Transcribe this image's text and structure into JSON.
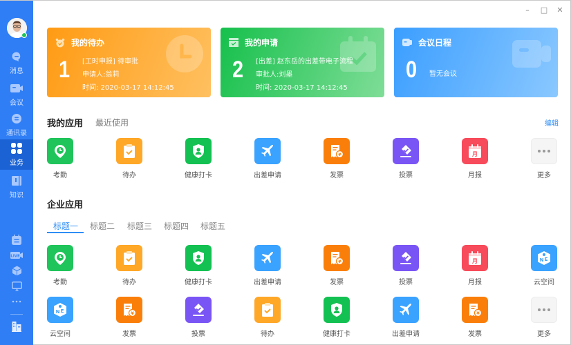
{
  "window": {
    "controls": {
      "minimize": "–",
      "maximize": "□",
      "close": "✕"
    }
  },
  "sidebar": {
    "avatar": {
      "status": "online",
      "status_color": "#1fc45a"
    },
    "nav": [
      {
        "label": "消息",
        "icon": "message-icon",
        "active": false
      },
      {
        "label": "会议",
        "icon": "meeting-icon",
        "active": false
      },
      {
        "label": "通讯录",
        "icon": "contacts-icon",
        "active": false
      },
      {
        "label": "业务",
        "icon": "apps-grid-icon",
        "active": true
      },
      {
        "label": "知识",
        "icon": "knowledge-book-icon",
        "active": false
      }
    ],
    "tools": [
      {
        "icon": "calendar-icon"
      },
      {
        "icon": "live-icon",
        "text": "LIVE"
      },
      {
        "icon": "cube-icon"
      },
      {
        "icon": "screen-icon"
      },
      {
        "icon": "more-icon",
        "text": "•••"
      }
    ],
    "bottom": {
      "icon": "organization-icon"
    },
    "colors": {
      "background": "#2f7ef5",
      "active": "#1b62d4"
    }
  },
  "cards": [
    {
      "title": "我的待办",
      "icon": "alarm-clock-icon",
      "count": "1",
      "lines": [
        "[工时申报] 待审批",
        "申请人:翁莉",
        "时间: 2020-03-17  14:12:45"
      ],
      "color": "#ff9b14"
    },
    {
      "title": "我的申请",
      "icon": "calendar-check-icon",
      "count": "2",
      "lines": [
        "[出差] 赵东岳的出差带电子流程",
        "审批人:刘墨",
        "时间: 2020-03-17  14:12:45"
      ],
      "color": "#16c04c"
    },
    {
      "title": "会议日程",
      "icon": "video-camera-icon",
      "count": "0",
      "empty": "暂无会议",
      "color": "#3b9eff"
    }
  ],
  "my_apps": {
    "title": "我的应用",
    "recent": "最近使用",
    "edit": "编辑",
    "items": [
      {
        "label": "考勤",
        "icon": "attendance-icon",
        "color": "#1fc45a"
      },
      {
        "label": "待办",
        "icon": "todo-clipboard-icon",
        "color": "#ffa727"
      },
      {
        "label": "健康打卡",
        "icon": "health-shield-icon",
        "color": "#13c152"
      },
      {
        "label": "出差申请",
        "icon": "airplane-icon",
        "color": "#3aa2ff"
      },
      {
        "label": "发票",
        "icon": "invoice-icon",
        "color": "#fa7f0a"
      },
      {
        "label": "投票",
        "icon": "vote-icon",
        "color": "#7a55f5"
      },
      {
        "label": "月报",
        "icon": "monthly-report-icon",
        "color": "#f74a5a"
      },
      {
        "label": "更多",
        "icon": "more-icon",
        "color": "#f5f5f5"
      }
    ]
  },
  "enterprise_apps": {
    "title": "企业应用",
    "tabs": [
      {
        "label": "标题一",
        "active": true
      },
      {
        "label": "标题二",
        "active": false
      },
      {
        "label": "标题三",
        "active": false
      },
      {
        "label": "标题四",
        "active": false
      },
      {
        "label": "标题五",
        "active": false
      }
    ],
    "rows": [
      [
        {
          "label": "考勤",
          "icon": "attendance-icon",
          "color": "#1fc45a"
        },
        {
          "label": "待办",
          "icon": "todo-clipboard-icon",
          "color": "#ffa727"
        },
        {
          "label": "健康打卡",
          "icon": "health-shield-icon",
          "color": "#13c152"
        },
        {
          "label": "出差申请",
          "icon": "airplane-icon",
          "color": "#3aa2ff"
        },
        {
          "label": "发票",
          "icon": "invoice-icon",
          "color": "#fa7f0a"
        },
        {
          "label": "投票",
          "icon": "vote-icon",
          "color": "#7a55f5"
        },
        {
          "label": "月报",
          "icon": "monthly-report-icon",
          "color": "#f74a5a"
        },
        {
          "label": "云空间",
          "icon": "cloud-space-icon",
          "color": "#3aa2ff"
        }
      ],
      [
        {
          "label": "云空间",
          "icon": "cloud-space-icon",
          "color": "#3aa2ff"
        },
        {
          "label": "发票",
          "icon": "invoice-icon",
          "color": "#fa7f0a"
        },
        {
          "label": "投票",
          "icon": "vote-icon",
          "color": "#7a55f5"
        },
        {
          "label": "待办",
          "icon": "todo-clipboard-icon",
          "color": "#ffa727"
        },
        {
          "label": "健康打卡",
          "icon": "health-shield-icon",
          "color": "#13c152"
        },
        {
          "label": "出差申请",
          "icon": "airplane-icon",
          "color": "#3aa2ff"
        },
        {
          "label": "发票",
          "icon": "invoice-icon",
          "color": "#fa7f0a"
        },
        {
          "label": "更多",
          "icon": "more-icon",
          "color": "#f5f5f5"
        }
      ]
    ]
  }
}
